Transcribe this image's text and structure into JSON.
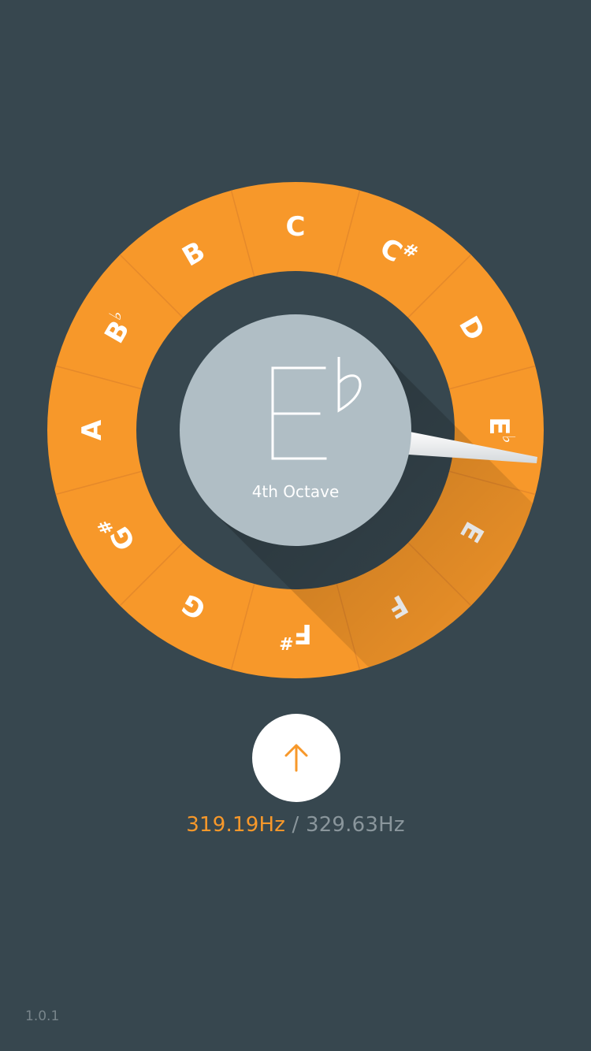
{
  "colors": {
    "background": "#37474f",
    "ring": "#f7982a",
    "ring_divider": "#e5892a",
    "hub": "#b0bec5",
    "accent": "#f7982a",
    "muted_text": "#8a969c"
  },
  "wheel": {
    "notes": [
      {
        "letter": "C",
        "sym": ""
      },
      {
        "letter": "C",
        "sym": "#"
      },
      {
        "letter": "D",
        "sym": ""
      },
      {
        "letter": "E",
        "sym": "♭"
      },
      {
        "letter": "E",
        "sym": ""
      },
      {
        "letter": "F",
        "sym": ""
      },
      {
        "letter": "F",
        "sym": "#"
      },
      {
        "letter": "G",
        "sym": ""
      },
      {
        "letter": "G",
        "sym": "#"
      },
      {
        "letter": "A",
        "sym": ""
      },
      {
        "letter": "B",
        "sym": "♭"
      },
      {
        "letter": "B",
        "sym": ""
      }
    ],
    "active_index": 3
  },
  "display": {
    "note_letter": "E",
    "note_accidental": "♭",
    "octave": "4th Octave"
  },
  "tune_button": {
    "icon": "arrow-up-icon"
  },
  "frequency": {
    "current": "319.19Hz",
    "separator": "/",
    "target": "329.63Hz"
  },
  "version": "1.0.1"
}
